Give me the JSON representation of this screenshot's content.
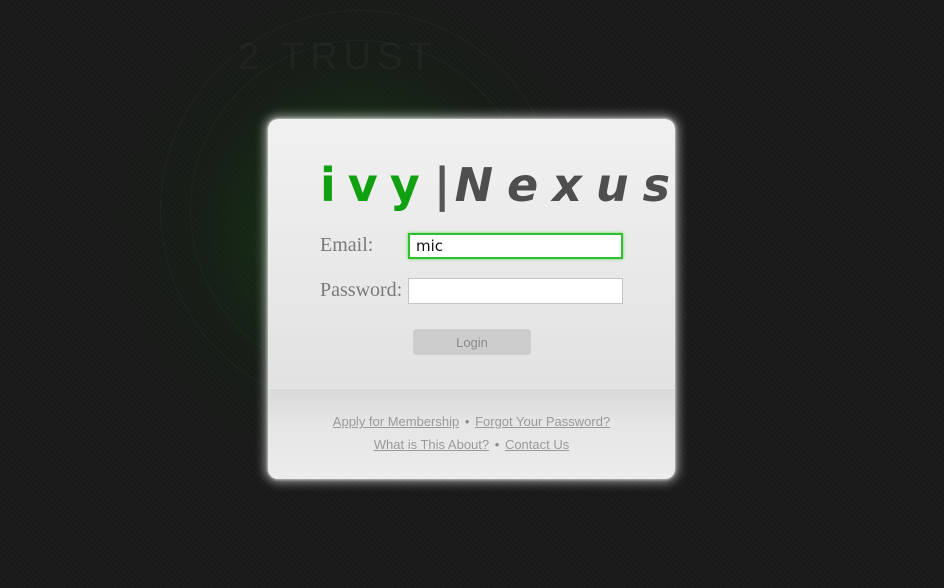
{
  "background_text": "2 TRUST",
  "logo": {
    "part1": "ivy",
    "separator": "|",
    "part2": "Nexus"
  },
  "form": {
    "email_label": "Email:",
    "email_value": "mic",
    "password_label": "Password:",
    "password_value": "",
    "login_label": "Login"
  },
  "footer": {
    "apply_link": "Apply for Membership",
    "forgot_link": "Forgot Your Password?",
    "about_link": "What is This About?",
    "contact_link": "Contact Us",
    "separator": "•"
  },
  "colors": {
    "accent": "#11a011",
    "focus_border": "#2fbf2f",
    "background": "#1a1a1a"
  }
}
